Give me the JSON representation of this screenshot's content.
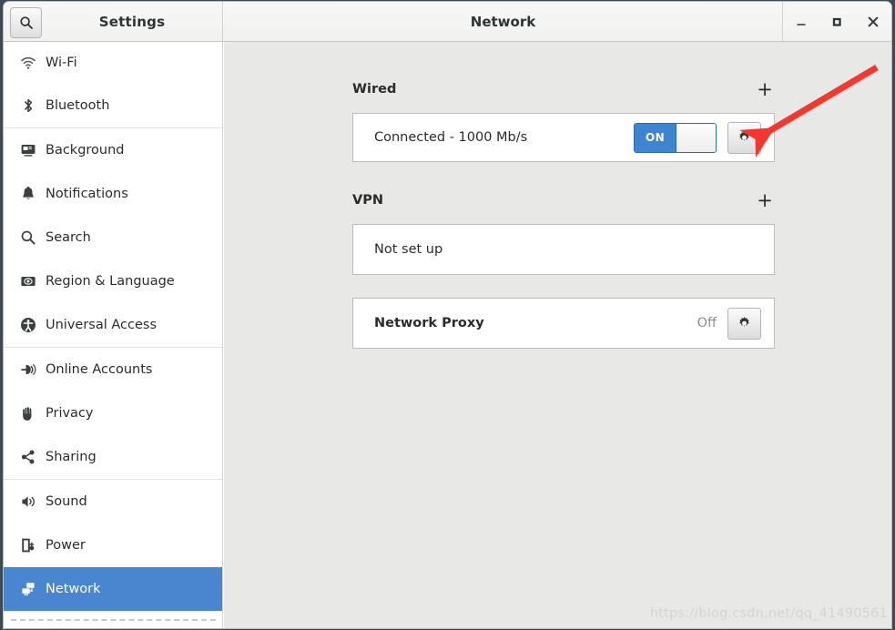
{
  "window": {
    "left_title": "Settings",
    "title": "Network",
    "controls": {
      "minimize": "minimize-icon",
      "maximize": "maximize-icon",
      "close": "close-icon"
    },
    "search_icon": "search-icon"
  },
  "sidebar": {
    "groups": [
      {
        "items": [
          {
            "label": "Wi-Fi",
            "icon": "wifi-icon",
            "selected": false
          },
          {
            "label": "Bluetooth",
            "icon": "bluetooth-icon",
            "selected": false
          }
        ]
      },
      {
        "items": [
          {
            "label": "Background",
            "icon": "background-icon",
            "selected": false
          },
          {
            "label": "Notifications",
            "icon": "bell-icon",
            "selected": false
          },
          {
            "label": "Search",
            "icon": "search-icon",
            "selected": false
          },
          {
            "label": "Region & Language",
            "icon": "region-language-icon",
            "selected": false
          },
          {
            "label": "Universal Access",
            "icon": "universal-access-icon",
            "selected": false
          }
        ]
      },
      {
        "items": [
          {
            "label": "Online Accounts",
            "icon": "online-accounts-icon",
            "selected": false
          },
          {
            "label": "Privacy",
            "icon": "privacy-hand-icon",
            "selected": false
          },
          {
            "label": "Sharing",
            "icon": "sharing-icon",
            "selected": false
          }
        ]
      },
      {
        "items": [
          {
            "label": "Sound",
            "icon": "sound-icon",
            "selected": false
          },
          {
            "label": "Power",
            "icon": "power-icon",
            "selected": false
          },
          {
            "label": "Network",
            "icon": "network-icon",
            "selected": true
          }
        ]
      }
    ]
  },
  "main": {
    "wired": {
      "heading": "Wired",
      "add_label": "+",
      "add_icon": "plus-icon",
      "status": "Connected - 1000 Mb/s",
      "toggle_state": "ON",
      "settings_icon": "gear-icon"
    },
    "vpn": {
      "heading": "VPN",
      "add_label": "+",
      "add_icon": "plus-icon",
      "status": "Not set up"
    },
    "proxy": {
      "label": "Network Proxy",
      "status": "Off",
      "settings_icon": "gear-icon"
    }
  },
  "annotation": {
    "arrow_color": "#f4372f",
    "arrow_name": "red-pointer-arrow"
  },
  "watermark": {
    "text": "https://blog.csdn.net/qq_41490561"
  },
  "colors": {
    "accent": "#4a86cf",
    "toggle_on": "#3d85d0",
    "content_bg": "#e8e8e7",
    "sidebar_bg": "#ffffff"
  }
}
